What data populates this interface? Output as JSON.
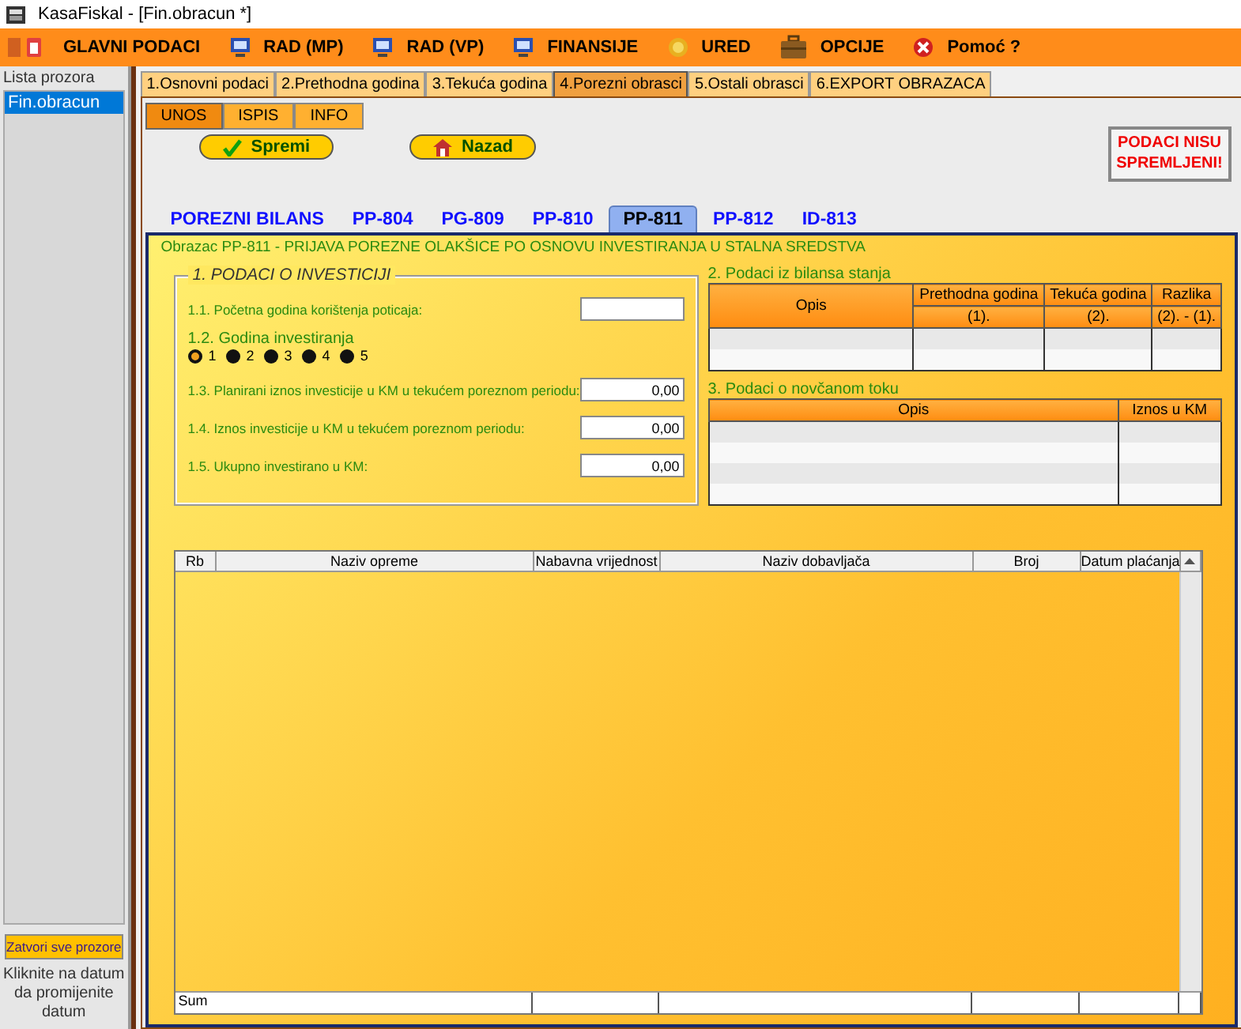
{
  "window": {
    "title": "KasaFiskal  - [Fin.obracun *]"
  },
  "menu": [
    {
      "label": "GLAVNI PODACI"
    },
    {
      "label": "RAD (MP)"
    },
    {
      "label": "RAD (VP)"
    },
    {
      "label": "FINANSIJE"
    },
    {
      "label": "URED"
    },
    {
      "label": "OPCIJE"
    },
    {
      "label": "Pomoć ?"
    }
  ],
  "sidebar": {
    "title": "Lista prozora",
    "items": [
      {
        "label": "Fin.obracun",
        "selected": true
      }
    ],
    "close_button": "Zatvori sve prozore",
    "hint": "Kliknite na datum da promijenite datum"
  },
  "main_tabs": [
    {
      "label": "1.Osnovni podaci",
      "selected": false
    },
    {
      "label": "2.Prethodna godina",
      "selected": false
    },
    {
      "label": "3.Tekuća godina",
      "selected": false
    },
    {
      "label": "4.Porezni obrasci",
      "selected": true
    },
    {
      "label": "5.Ostali obrasci",
      "selected": false
    },
    {
      "label": "6.EXPORT OBRAZACA",
      "selected": false
    }
  ],
  "sub_tabs": [
    {
      "label": "UNOS",
      "selected": true
    },
    {
      "label": "ISPIS",
      "selected": false
    },
    {
      "label": "INFO",
      "selected": false
    }
  ],
  "buttons": [
    {
      "label": "Spremi",
      "kind": "save"
    },
    {
      "label": "Nazad",
      "kind": "home"
    }
  ],
  "status": "PODACI NISU SPREMLJENI!",
  "form_tabs": [
    {
      "label": "POREZNI BILANS",
      "selected": false
    },
    {
      "label": "PP-804",
      "selected": false
    },
    {
      "label": "PG-809",
      "selected": false
    },
    {
      "label": "PP-810",
      "selected": false
    },
    {
      "label": "PP-811",
      "selected": true
    },
    {
      "label": "PP-812",
      "selected": false
    },
    {
      "label": "ID-813",
      "selected": false
    }
  ],
  "form_title": "Obrazac PP-811 - PRIJAVA POREZNE OLAKŠICE PO OSNOVU INVESTIRANJA U STALNA SREDSTVA",
  "investment": {
    "legend": "1. PODACI O INVESTICIJI",
    "start_year": {
      "label": "1.1. Početna godina korištenja poticaja:"
    },
    "year_label": "1.2. Godina investiranja",
    "years": [
      {
        "label": "1",
        "selected": true
      },
      {
        "label": "2",
        "selected": false
      },
      {
        "label": "3",
        "selected": false
      },
      {
        "label": "4",
        "selected": false
      },
      {
        "label": "5",
        "selected": false
      }
    ],
    "fields": [
      {
        "label": "1.3. Planirani iznos investicije u KM u tekućem poreznom periodu:",
        "value": "0,00"
      },
      {
        "label": "1.4. Iznos investicije u KM u tekućem poreznom periodu:",
        "value": "0,00"
      },
      {
        "label": "1.5. Ukupno investirano u KM:",
        "value": "0,00"
      }
    ]
  },
  "balance": {
    "title": "2. Podaci iz bilansa stanja",
    "columns": [
      {
        "label": "Opis"
      },
      {
        "label": "Prethodna godina",
        "sub": "(1)."
      },
      {
        "label": "Tekuća godina",
        "sub": "(2)."
      },
      {
        "label": "Razlika",
        "sub": "(2). - (1)."
      }
    ]
  },
  "cashflow": {
    "title": "3. Podaci o novčanom toku",
    "columns": [
      "Opis",
      "Iznos u KM"
    ]
  },
  "table": {
    "columns": [
      "Rb",
      "Naziv opreme",
      "Nabavna vrijednost",
      "Naziv dobavljača",
      "Broj",
      "Datum plaćanja"
    ],
    "footer": "Sum"
  }
}
